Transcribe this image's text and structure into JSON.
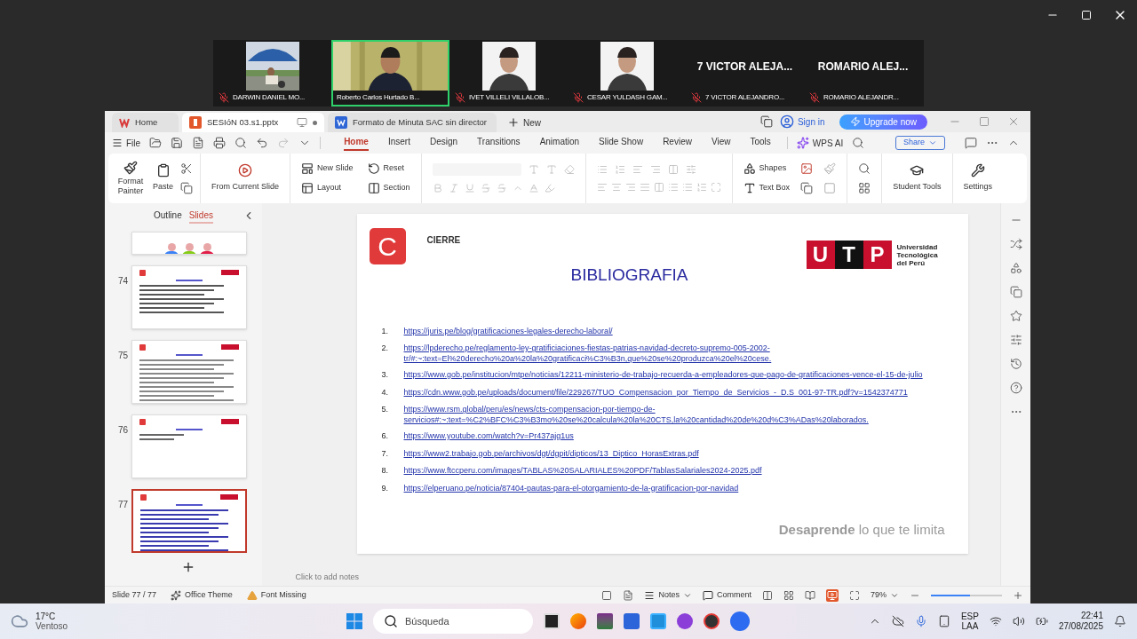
{
  "participants": [
    {
      "name": "DARWIN DANIEL MO...",
      "kind": "video",
      "muted": true,
      "speaking": false
    },
    {
      "name": "Roberto Carlos Hurtado B...",
      "kind": "video",
      "muted": false,
      "speaking": true
    },
    {
      "name": "IVET VILLELI VILLALOB...",
      "muted": true,
      "speaking": false
    },
    {
      "name": "CESAR YULDASH GAM...",
      "muted": true,
      "speaking": false
    },
    {
      "name": "7 VICTOR ALEJANDRO...",
      "kind": "name",
      "tile_text": "7 VICTOR ALEJA...",
      "muted": true,
      "speaking": false
    },
    {
      "name": "ROMARIO ALEJANDR...",
      "kind": "name",
      "tile_text": "ROMARIO ALEJ...",
      "muted": true,
      "speaking": false
    }
  ],
  "tabs": [
    {
      "label": "Home",
      "kind": "home",
      "selected": false
    },
    {
      "label": "SESIóN 03.s1.pptx",
      "kind": "presentation",
      "selected": true
    },
    {
      "label": "Formato de Minuta SAC sin director",
      "kind": "document",
      "selected": false
    }
  ],
  "new_tab": "New",
  "sign_in": "Sign in",
  "upgrade": "Upgrade now",
  "file_menu": "File",
  "ribbon_tabs": [
    {
      "label": "Home",
      "selected": true
    },
    {
      "label": "Insert",
      "selected": false
    },
    {
      "label": "Design",
      "selected": false
    },
    {
      "label": "Transitions",
      "selected": false
    },
    {
      "label": "Animation",
      "selected": false
    },
    {
      "label": "Slide Show",
      "selected": false
    },
    {
      "label": "Review",
      "selected": false
    },
    {
      "label": "View",
      "selected": false
    },
    {
      "label": "Tools",
      "selected": false
    }
  ],
  "wps_ai": "WPS AI",
  "share": "Share",
  "ribbon": {
    "format_painter": "Format Painter",
    "paste": "Paste",
    "from_current_slide": "From Current Slide",
    "new_slide": "New Slide",
    "reset": "Reset",
    "layout": "Layout",
    "section": "Section",
    "shapes": "Shapes",
    "text_box": "Text Box",
    "student_tools": "Student Tools",
    "settings": "Settings"
  },
  "panel_tabs": [
    {
      "label": "Outline",
      "selected": false
    },
    {
      "label": "Slides",
      "selected": true
    }
  ],
  "thumbnails": [
    {
      "kind": "people",
      "selected": false
    },
    {
      "number": "74",
      "kind": "list",
      "selected": false
    },
    {
      "number": "75",
      "kind": "paragraphs",
      "selected": false
    },
    {
      "number": "76",
      "kind": "short",
      "selected": false
    },
    {
      "number": "77",
      "kind": "links",
      "selected": true
    }
  ],
  "slide": {
    "logo_letter": "C",
    "tag": "CIERRE",
    "title": "BIBLIOGRAFIA",
    "brand_letters": [
      "U",
      "T",
      "P"
    ],
    "brand_name": "Universidad Tecnológica del Perú",
    "references": [
      {
        "number": "1.",
        "url": "https://juris.pe/blog/gratificaciones-legales-derecho-laboral/"
      },
      {
        "number": "2.",
        "url": "https://lpderecho.pe/reglamento-ley-gratificiaciones-fiestas-patrias-navidad-decreto-supremo-005-2002-tr/#:~:text=El%20derecho%20a%20la%20gratificaci%C3%B3n,que%20se%20produzca%20el%20cese."
      },
      {
        "number": "3.",
        "url": "https://www.gob.pe/institucion/mtpe/noticias/12211-ministerio-de-trabajo-recuerda-a-empleadores-que-pago-de-gratificaciones-vence-el-15-de-julio"
      },
      {
        "number": "4.",
        "url": "https://cdn.www.gob.pe/uploads/document/file/229267/TUO_Compensacion_por_Tiempo_de_Servicios_-_D.S_001-97-TR.pdf?v=1542374771"
      },
      {
        "number": "5.",
        "url": "https://www.rsm.global/peru/es/news/cts-compensacion-por-tiempo-de-servicios#:~:text=%C2%BFC%C3%B3mo%20se%20calcula%20la%20CTS,la%20cantidad%20de%20d%C3%ADas%20laborados."
      },
      {
        "number": "6.",
        "url": "https://www.youtube.com/watch?v=Pr437ajg1us"
      },
      {
        "number": "7.",
        "url": "https://www2.trabajo.gob.pe/archivos/dgt/dgpit/dipticos/13_Diptico_HorasExtras.pdf"
      },
      {
        "number": "8.",
        "url": "https://www.ftccperu.com/images/TABLAS%20SALARIALES%20PDF/TablasSalariales2024-2025.pdf"
      },
      {
        "number": "9.",
        "url": "https://elperuano.pe/noticia/87404-pautas-para-el-otorgamiento-de-la-gratificacion-por-navidad"
      }
    ],
    "slogan": "**Desaprende** lo que te limita"
  },
  "notes_placeholder": "Click to add notes",
  "status": {
    "slide_count": "Slide 77 / 77",
    "theme": "Office Theme",
    "font_missing": "Font Missing",
    "notes": "Notes",
    "comment": "Comment",
    "zoom": "79%",
    "zoom_slider": {
      "level": 0.55
    }
  },
  "taskbar": {
    "temperature": "17°C",
    "weather": "Ventoso",
    "search_placeholder": "Búsqueda",
    "language": "ESP",
    "layout": "LAA",
    "time": "22:41",
    "date": "27/08/2025"
  }
}
